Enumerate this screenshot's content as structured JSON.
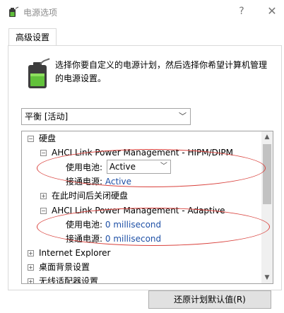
{
  "window": {
    "title": "电源选项",
    "help_label": "?",
    "close_label": "✕"
  },
  "tabs": [
    {
      "label": "高级设置",
      "selected": true
    }
  ],
  "description": "选择你要自定义的电源计划，然后选择你希望计算机管理的电源设置。",
  "plan_select": {
    "value": "平衡 [活动]"
  },
  "tree": {
    "items": {
      "disk": {
        "label": "硬盘",
        "expander": "⊟"
      },
      "hipm": {
        "label": "AHCI Link Power Management - HIPM/DIPM",
        "expander": "⊟"
      },
      "hipm_battery": {
        "label": "使用电池:",
        "value": "Active"
      },
      "hipm_plugged": {
        "label": "接通电源:",
        "value": "Active"
      },
      "disk_off": {
        "label": "在此时间后关闭硬盘",
        "expander": "⊞"
      },
      "adaptive": {
        "label": "AHCI Link Power Management - Adaptive",
        "expander": "⊟"
      },
      "adaptive_battery": {
        "label": "使用电池:",
        "value": "0 millisecond"
      },
      "adaptive_plugged": {
        "label": "接通电源:",
        "value": "0 millisecond"
      },
      "ie": {
        "label": "Internet Explorer",
        "expander": "⊞"
      },
      "desktop_bg": {
        "label": "桌面背景设置",
        "expander": "⊞"
      },
      "wireless": {
        "label": "无线适配器设置",
        "expander": "⊞"
      }
    }
  },
  "buttons": {
    "restore_label": "还原计划默认值(R)"
  },
  "colors": {
    "annotation_red": "#d9413c",
    "value_blue": "#1e50a6"
  }
}
